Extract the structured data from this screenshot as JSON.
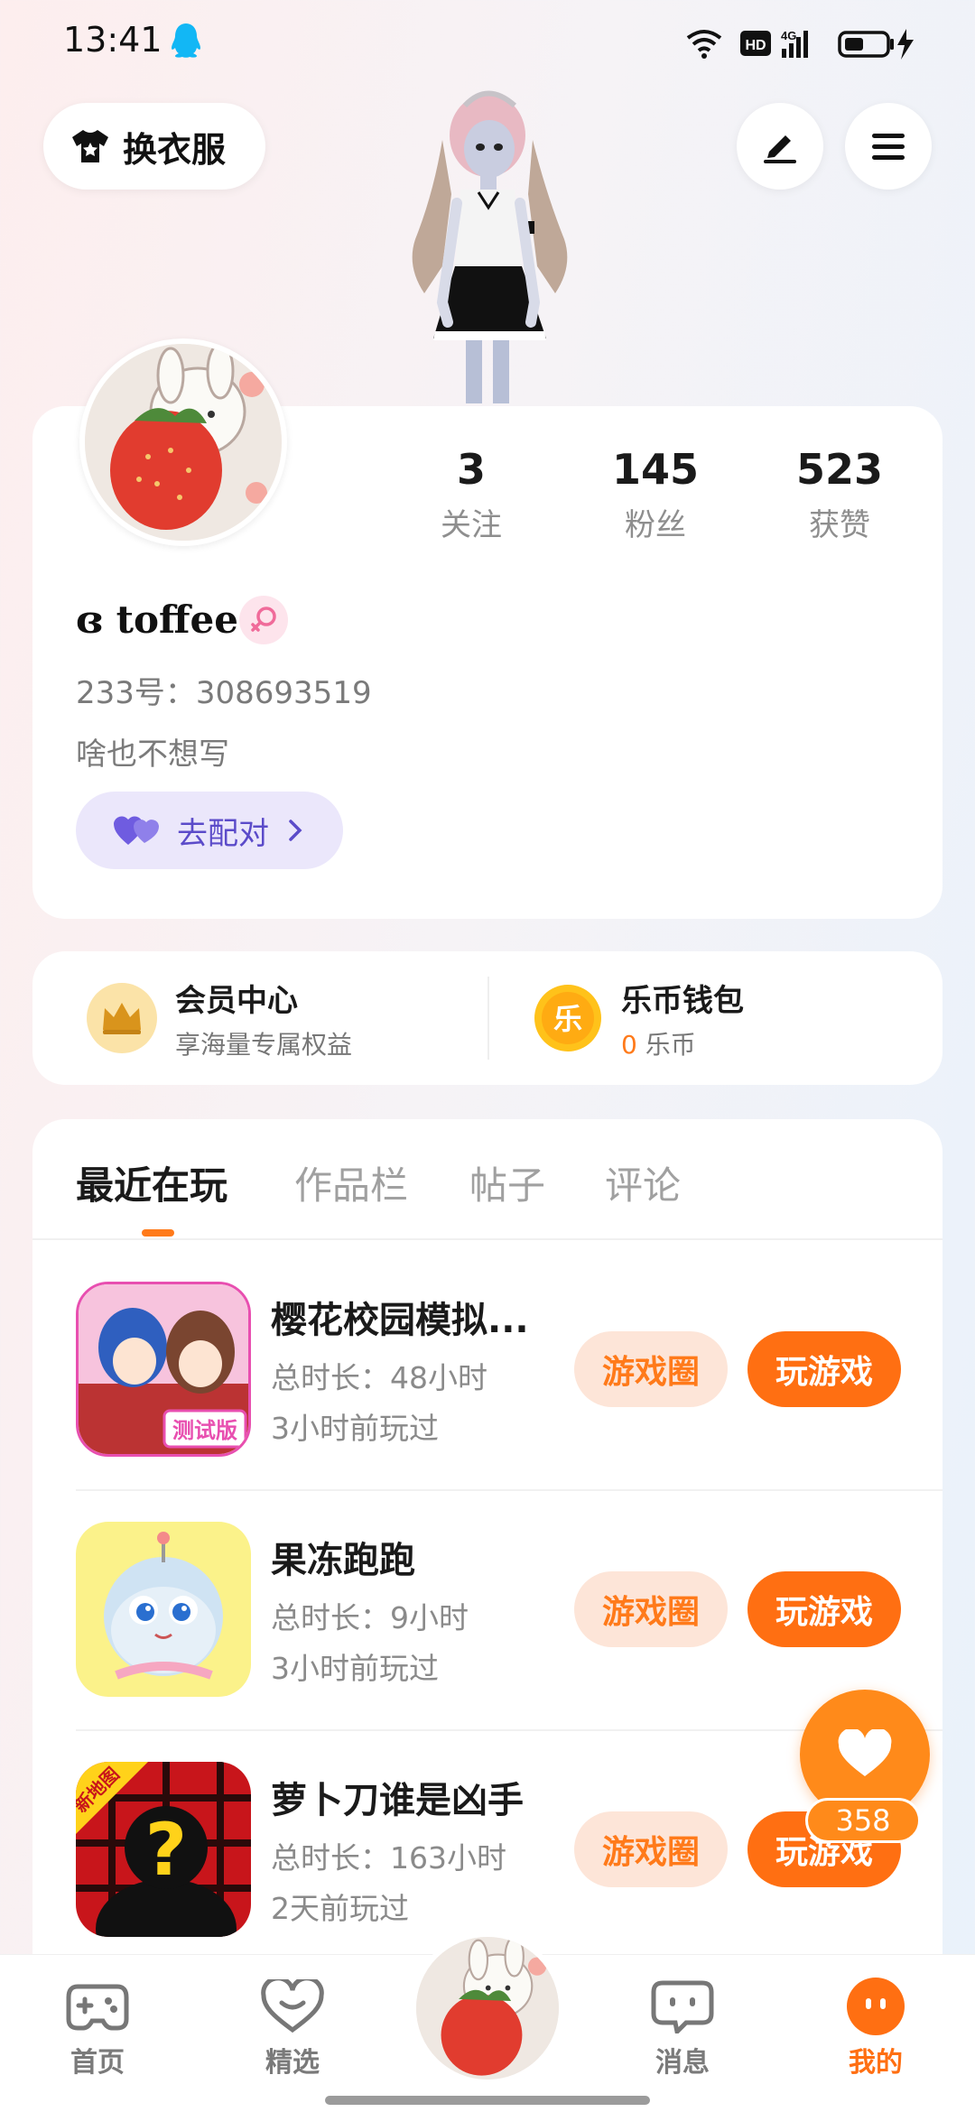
{
  "status_bar": {
    "time": "13:41",
    "hd": "HD",
    "network": "4G"
  },
  "header": {
    "outfit_label": "换衣服"
  },
  "profile": {
    "username": "ɞ toffee ɞ",
    "stats": [
      {
        "value": "3",
        "label": "关注"
      },
      {
        "value": "145",
        "label": "粉丝"
      },
      {
        "value": "523",
        "label": "获赞"
      }
    ],
    "uid_text": "233号：308693519",
    "bio": "啥也不想写",
    "match_label": "去配对"
  },
  "vip": {
    "title": "会员中心",
    "subtitle": "享海量专属权益"
  },
  "wallet": {
    "title": "乐币钱包",
    "coin_glyph": "乐",
    "amount": "0",
    "unit": "乐币"
  },
  "tabs": [
    {
      "label": "最近在玩",
      "active": true
    },
    {
      "label": "作品栏",
      "active": false
    },
    {
      "label": "帖子",
      "active": false
    },
    {
      "label": "评论",
      "active": false
    }
  ],
  "games": [
    {
      "name": "樱花校园模拟...",
      "duration": "总时长：48小时",
      "last_played": "3小时前玩过",
      "badge": "测试版",
      "circle_label": "游戏圈",
      "play_label": "玩游戏"
    },
    {
      "name": "果冻跑跑",
      "duration": "总时长：9小时",
      "last_played": "3小时前玩过",
      "circle_label": "游戏圈",
      "play_label": "玩游戏"
    },
    {
      "name": "萝卜刀谁是凶手",
      "duration": "总时长：163小时",
      "last_played": "2天前玩过",
      "badge": "新地图",
      "circle_label": "游戏圈",
      "play_label": "玩游戏"
    }
  ],
  "fab": {
    "count": "358"
  },
  "nav": [
    {
      "label": "首页",
      "icon": "gamepad-icon"
    },
    {
      "label": "精选",
      "icon": "heart-chat-icon"
    },
    {
      "label": "消息",
      "icon": "message-icon"
    },
    {
      "label": "我的",
      "icon": "profile-icon",
      "active": true
    }
  ],
  "colors": {
    "accent": "#ff6f12",
    "accent_light": "#fde5d8",
    "match_bg": "#ebe7fb",
    "match_text": "#5b4bc9"
  }
}
